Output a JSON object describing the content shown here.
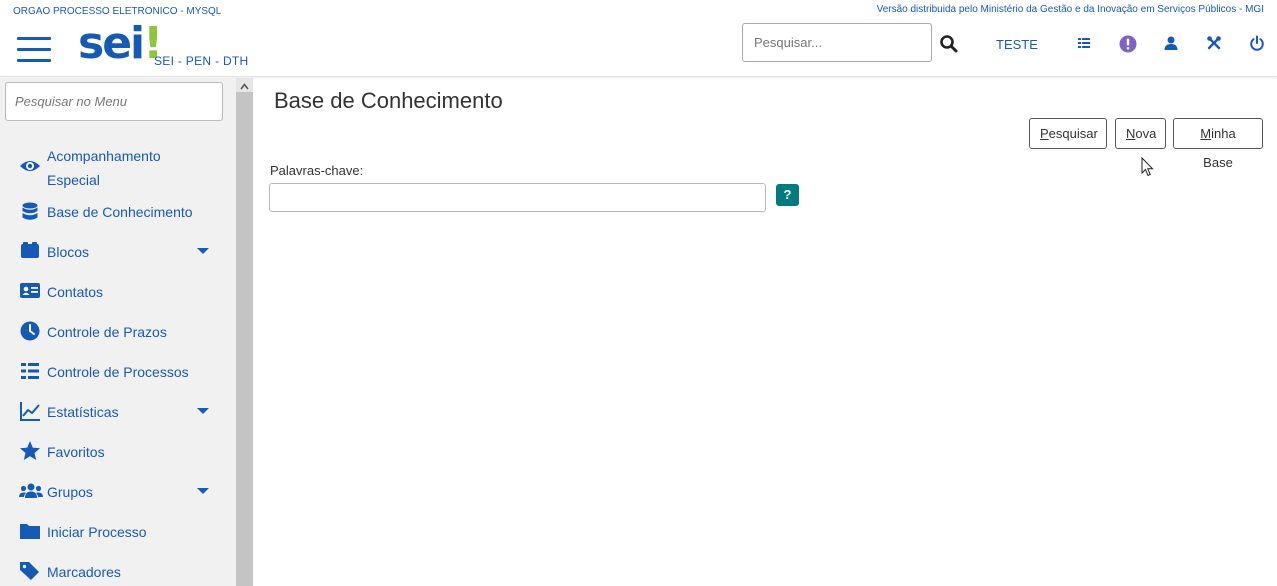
{
  "header": {
    "org": "ORGAO PROCESSO ELETRONICO - MYSQL",
    "version": "Versão distribuida pelo Ministério da Gestão e da Inovação em Serviços Públicos - MGI",
    "logo_text": "sei",
    "logo_bang": "!",
    "subtitle": "SEI - PEN - DTH",
    "search_placeholder": "Pesquisar...",
    "user": "TESTE",
    "icons": [
      "search-icon",
      "grid-icon",
      "alert-icon",
      "user-icon",
      "tools-icon",
      "power-icon"
    ],
    "accent_color": "#155bb5",
    "alert_color": "#7f62c5"
  },
  "sidebar": {
    "search_placeholder": "Pesquisar no Menu",
    "items": [
      {
        "label": "Acompanhamento",
        "label2": "Especial",
        "icon": "eye-icon",
        "has_submenu": false
      },
      {
        "label": "Base de Conhecimento",
        "icon": "database-icon",
        "has_submenu": false
      },
      {
        "label": "Blocos",
        "icon": "blocks-icon",
        "has_submenu": true
      },
      {
        "label": "Contatos",
        "icon": "contact-card-icon",
        "has_submenu": false
      },
      {
        "label": "Controle de Prazos",
        "icon": "clock-icon",
        "has_submenu": false
      },
      {
        "label": "Controle de Processos",
        "icon": "list-icon",
        "has_submenu": false
      },
      {
        "label": "Estatísticas",
        "icon": "chart-line-icon",
        "has_submenu": true
      },
      {
        "label": "Favoritos",
        "icon": "star-icon",
        "has_submenu": false
      },
      {
        "label": "Grupos",
        "icon": "users-icon",
        "has_submenu": true
      },
      {
        "label": "Iniciar Processo",
        "icon": "folder-icon",
        "has_submenu": false
      },
      {
        "label": "Marcadores",
        "icon": "tag-icon",
        "has_submenu": false
      }
    ]
  },
  "main": {
    "title": "Base de Conhecimento",
    "buttons": {
      "pesquisar_key": "P",
      "pesquisar_rest": "esquisar",
      "nova_key": "N",
      "nova_rest": "ova",
      "minha_key": "M",
      "minha_rest": "inha Base"
    },
    "field_label": "Palavras-chave:",
    "field_value": "",
    "help_label": "?",
    "help_color": "#017b80"
  }
}
